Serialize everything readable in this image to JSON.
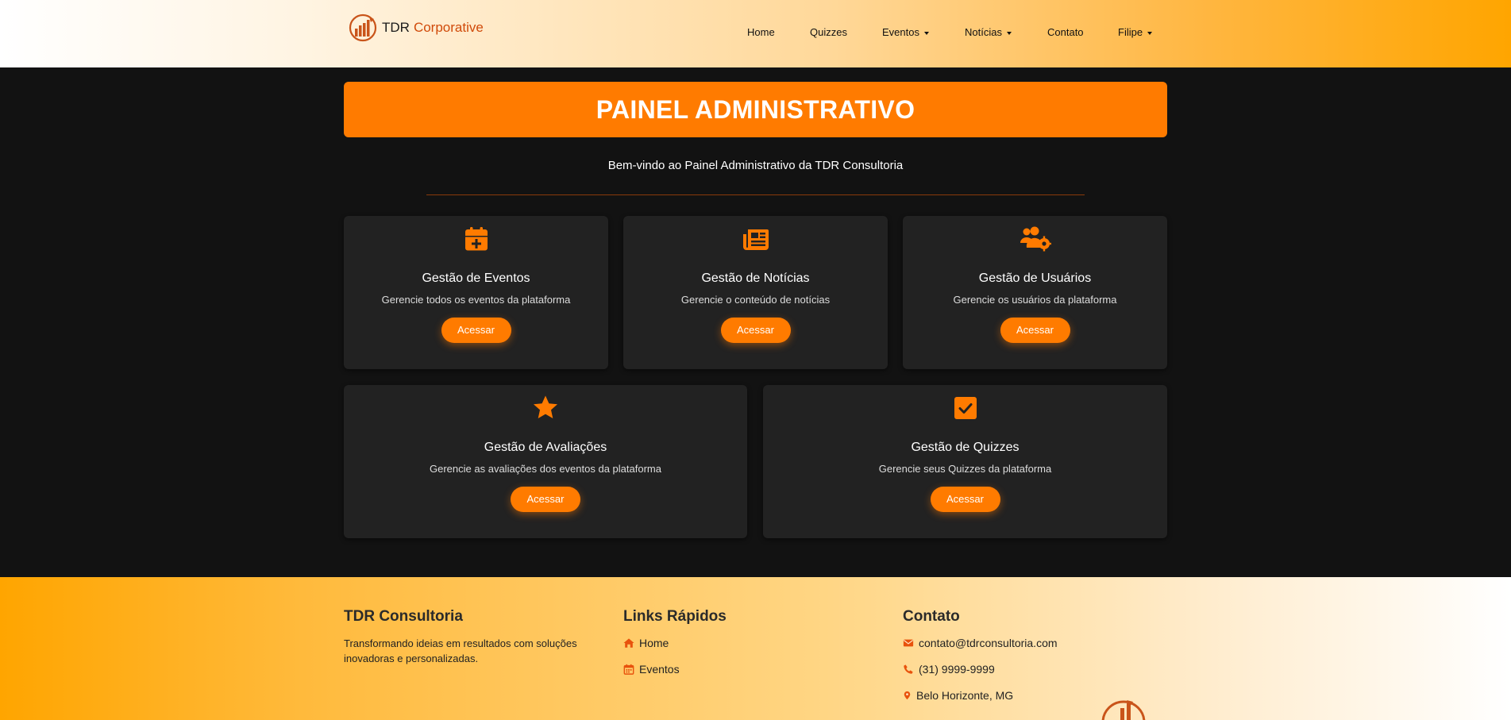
{
  "brand": {
    "name_part1": "TDR",
    "name_part2": "Corporative"
  },
  "nav": {
    "home": "Home",
    "quizzes": "Quizzes",
    "eventos": "Eventos",
    "noticias": "Notícias",
    "contato": "Contato",
    "user": "Filipe"
  },
  "main": {
    "banner_title": "PAINEL ADMINISTRATIVO",
    "welcome": "Bem-vindo ao Painel Administrativo da TDR Consultoria",
    "cards": [
      {
        "icon": "calendar-plus-icon",
        "title": "Gestão de Eventos",
        "description": "Gerencie todos os eventos da plataforma",
        "button": "Acessar"
      },
      {
        "icon": "newspaper-icon",
        "title": "Gestão de Notícias",
        "description": "Gerencie o conteúdo de notícias",
        "button": "Acessar"
      },
      {
        "icon": "users-gear-icon",
        "title": "Gestão de Usuários",
        "description": "Gerencie os usuários da plataforma",
        "button": "Acessar"
      },
      {
        "icon": "star-icon",
        "title": "Gestão de Avaliações",
        "description": "Gerencie as avaliações dos eventos da plataforma",
        "button": "Acessar"
      },
      {
        "icon": "check-square-icon",
        "title": "Gestão de Quizzes",
        "description": "Gerencie seus Quizzes da plataforma",
        "button": "Acessar"
      }
    ]
  },
  "footer": {
    "company": {
      "title": "TDR Consultoria",
      "text": "Transformando ideias em resultados com soluções inovadoras e personalizadas."
    },
    "links": {
      "title": "Links Rápidos",
      "items": [
        {
          "icon": "home-icon",
          "label": "Home"
        },
        {
          "icon": "calendar-icon",
          "label": "Eventos"
        }
      ]
    },
    "contact": {
      "title": "Contato",
      "items": [
        {
          "icon": "envelope-icon",
          "label": "contato@tdrconsultoria.com"
        },
        {
          "icon": "phone-icon",
          "label": "(31) 9999-9999"
        },
        {
          "icon": "location-pin-icon",
          "label": "Belo Horizonte, MG"
        }
      ]
    }
  },
  "colors": {
    "accent": "#ff7b00",
    "brand_red": "#d04a0a",
    "card_bg": "#222222",
    "page_bg": "#121212",
    "icon_orange": "#ff7b00",
    "footer_icon": "#e8520c"
  }
}
